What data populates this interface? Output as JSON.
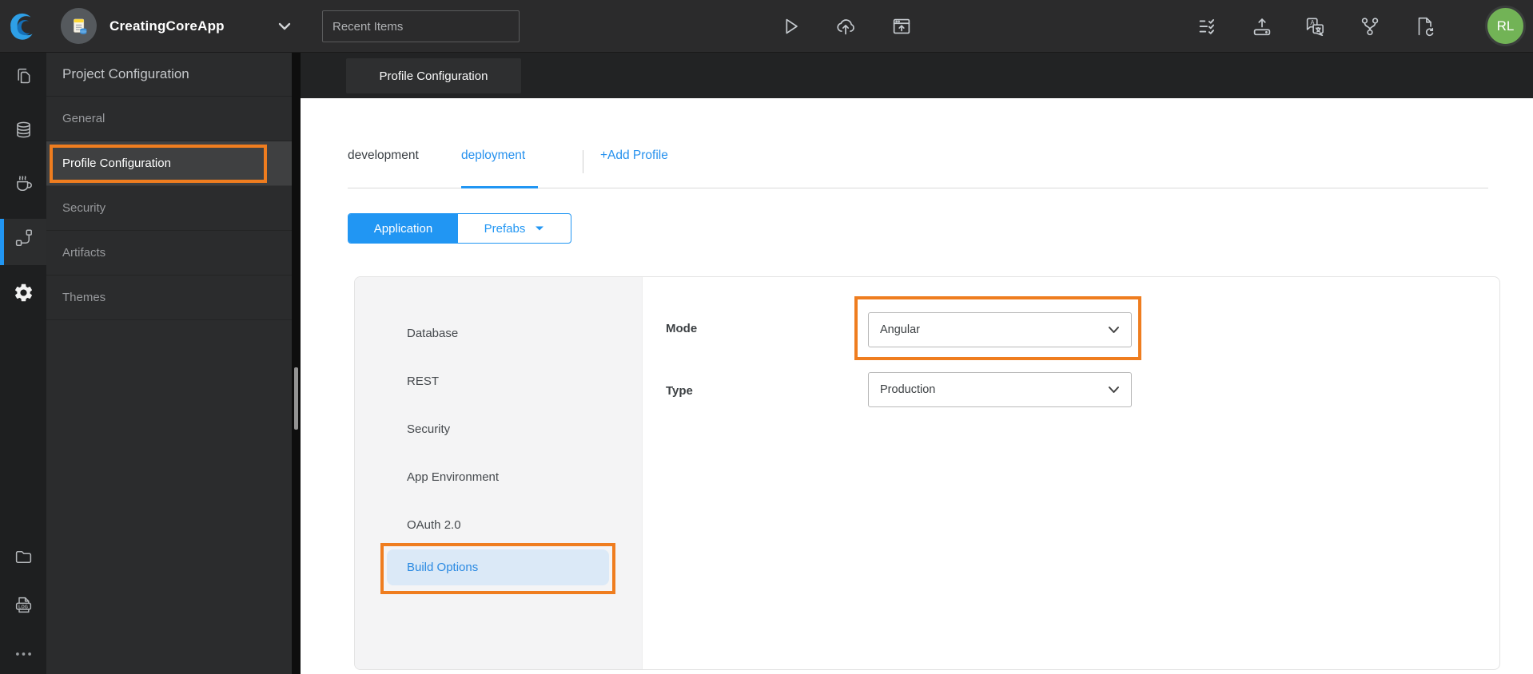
{
  "topbar": {
    "project_name": "CreatingCoreApp",
    "search_placeholder": "Recent Items",
    "avatar_initials": "RL"
  },
  "tabstrip": {
    "active_tab": "Profile Configuration"
  },
  "sidebar": {
    "title": "Project Configuration",
    "items": [
      {
        "label": "General",
        "active": false
      },
      {
        "label": "Profile Configuration",
        "active": true
      },
      {
        "label": "Security",
        "active": false
      },
      {
        "label": "Artifacts",
        "active": false
      },
      {
        "label": "Themes",
        "active": false
      }
    ]
  },
  "profile_tabs": {
    "tabs": [
      {
        "label": "development",
        "active": false
      },
      {
        "label": "deployment",
        "active": true
      }
    ],
    "add_label": "+Add Profile"
  },
  "scope_toggle": {
    "application": "Application",
    "prefabs": "Prefabs"
  },
  "settings_nav": {
    "items": [
      {
        "label": "Database",
        "active": false
      },
      {
        "label": "REST",
        "active": false
      },
      {
        "label": "Security",
        "active": false
      },
      {
        "label": "App Environment",
        "active": false
      },
      {
        "label": "OAuth 2.0",
        "active": false
      },
      {
        "label": "Build Options",
        "active": true
      }
    ]
  },
  "form": {
    "mode_label": "Mode",
    "mode_value": "Angular",
    "type_label": "Type",
    "type_value": "Production"
  },
  "colors": {
    "accent_blue": "#2196f3",
    "annotation_orange": "#ef7d1f",
    "avatar_green": "#72b356",
    "active_nav_bg": "#dbe9f7",
    "topbar_bg": "#2b2b2c",
    "sidebar_bg": "#2b2c2d"
  }
}
